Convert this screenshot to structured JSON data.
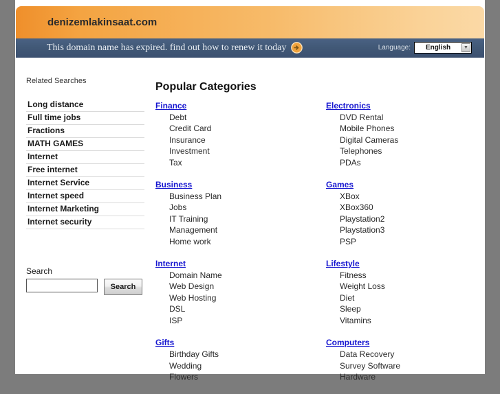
{
  "header": {
    "domain": "denizemlakinsaat.com",
    "notice": "This domain name has expired. find out how to renew it today",
    "renew_icon": "circle-arrow-right-icon",
    "language_label": "Language:",
    "language_value": "English",
    "language_options": [
      "English"
    ],
    "colors": {
      "orange_start": "#ef8f2b",
      "orange_end": "#fbd9a6",
      "notice_blue": "#415876",
      "link_blue": "#1717d0",
      "page_gray": "#7c7c7c"
    }
  },
  "sidebar": {
    "heading": "Related Searches",
    "items": [
      {
        "label": "Long distance"
      },
      {
        "label": "Full time jobs"
      },
      {
        "label": "Fractions"
      },
      {
        "label": "MATH GAMES"
      },
      {
        "label": "Internet"
      },
      {
        "label": "Free internet"
      },
      {
        "label": "Internet Service"
      },
      {
        "label": "Internet speed"
      },
      {
        "label": "Internet Marketing"
      },
      {
        "label": "Internet security"
      }
    ],
    "search": {
      "label": "Search",
      "value": "",
      "placeholder": "",
      "button_label": "Search"
    }
  },
  "main": {
    "heading": "Popular Categories",
    "columns": [
      {
        "groups": [
          {
            "title": "Finance",
            "items": [
              "Debt",
              "Credit Card",
              "Insurance",
              "Investment",
              "Tax"
            ]
          },
          {
            "title": "Business",
            "items": [
              "Business Plan",
              "Jobs",
              "IT Training",
              "Management",
              "Home work"
            ]
          },
          {
            "title": "Internet",
            "items": [
              "Domain Name",
              "Web Design",
              "Web Hosting",
              "DSL",
              "ISP"
            ]
          },
          {
            "title": "Gifts",
            "items": [
              "Birthday Gifts",
              "Wedding",
              "Flowers"
            ]
          }
        ]
      },
      {
        "groups": [
          {
            "title": "Electronics",
            "items": [
              "DVD Rental",
              "Mobile Phones",
              "Digital Cameras",
              "Telephones",
              "PDAs"
            ]
          },
          {
            "title": "Games",
            "items": [
              "XBox",
              "XBox360",
              "Playstation2",
              "Playstation3",
              "PSP"
            ]
          },
          {
            "title": "Lifestyle",
            "items": [
              "Fitness",
              "Weight Loss",
              "Diet",
              "Sleep",
              "Vitamins"
            ]
          },
          {
            "title": "Computers",
            "items": [
              "Data Recovery",
              "Survey Software",
              "Hardware"
            ]
          }
        ]
      }
    ]
  }
}
